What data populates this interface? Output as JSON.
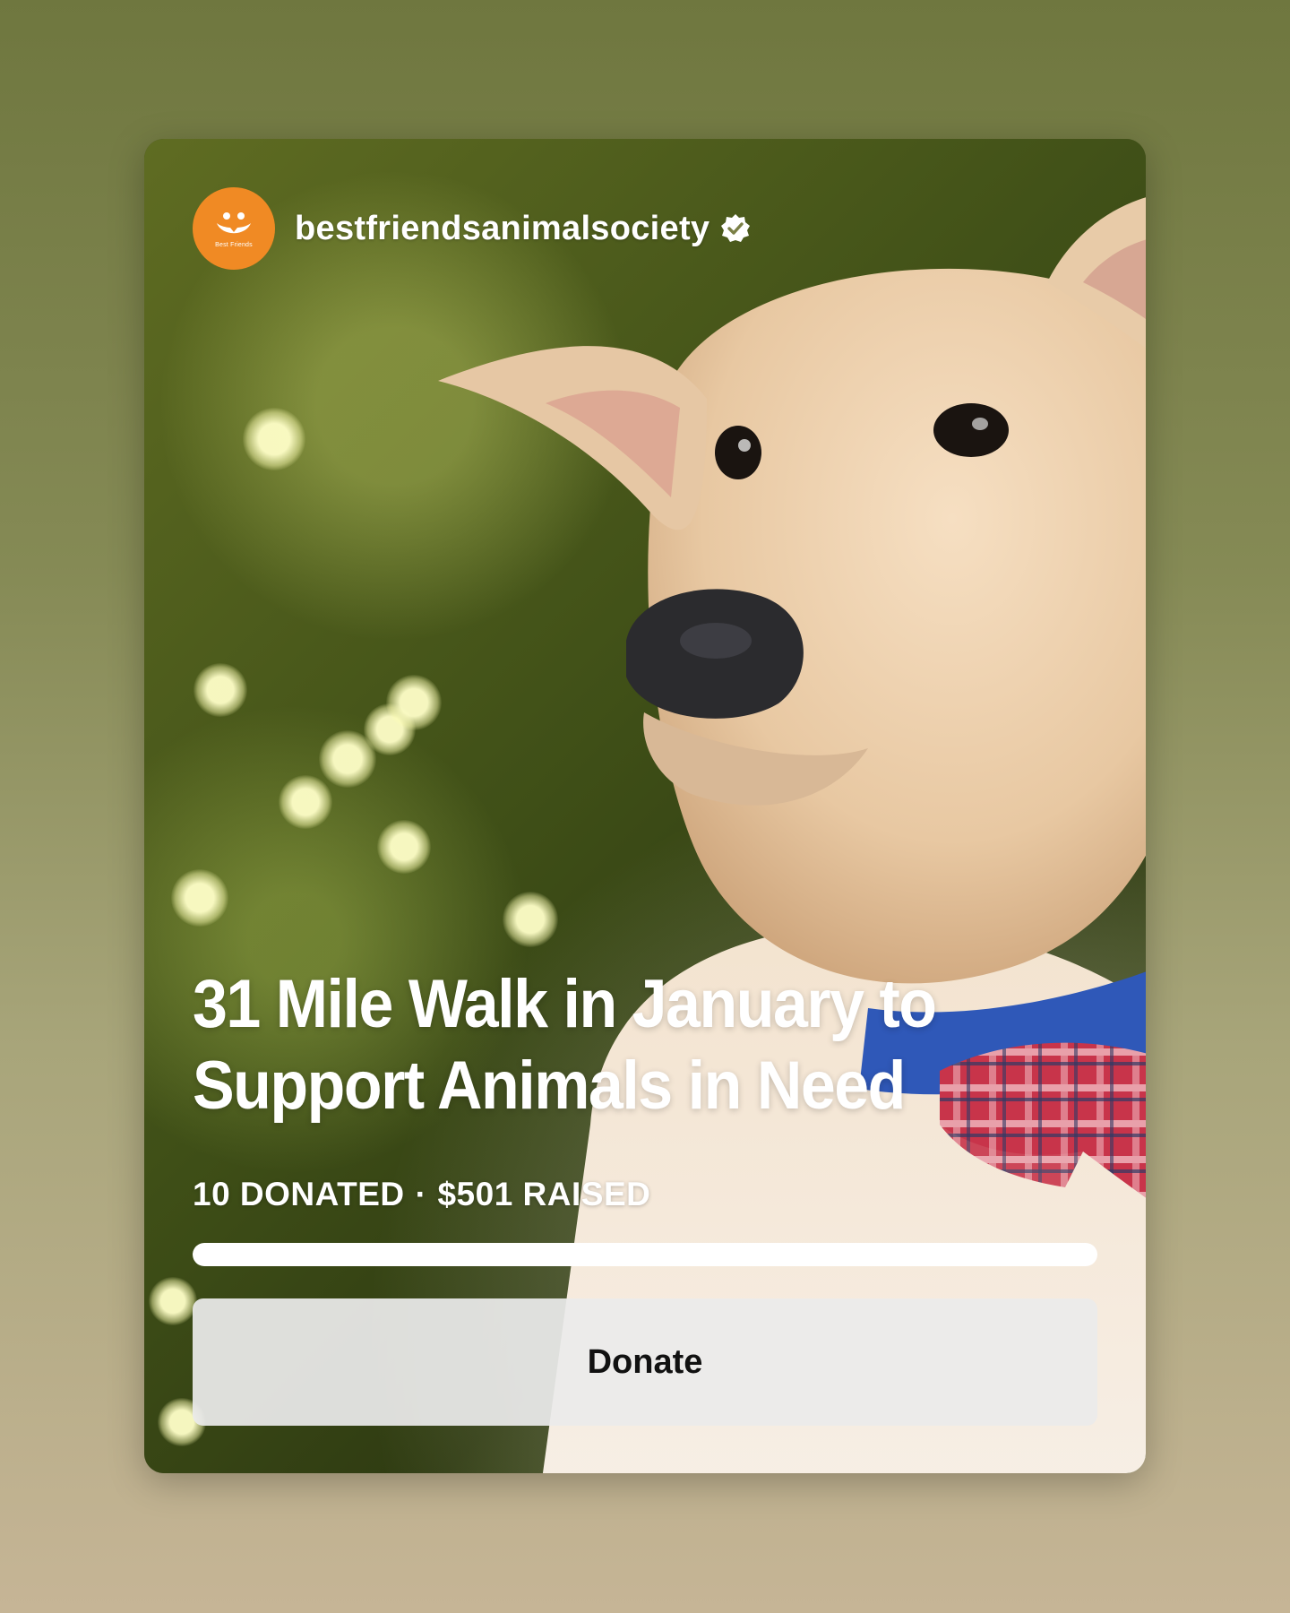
{
  "fundraiser": {
    "account_name": "bestfriendsanimalsociety",
    "avatar_label": "Best Friends",
    "verified_icon": "verified-badge-icon",
    "title": "31 Mile Walk in January to Support Animals in Need",
    "stats": {
      "donated": "10 DONATED",
      "separator": "·",
      "raised": "$501 RAISED"
    },
    "progress": 1.0,
    "donate_label": "Donate"
  },
  "colors": {
    "brand_orange": "#f08a24",
    "text": "#ffffff",
    "button_bg": "#ebebeb"
  }
}
